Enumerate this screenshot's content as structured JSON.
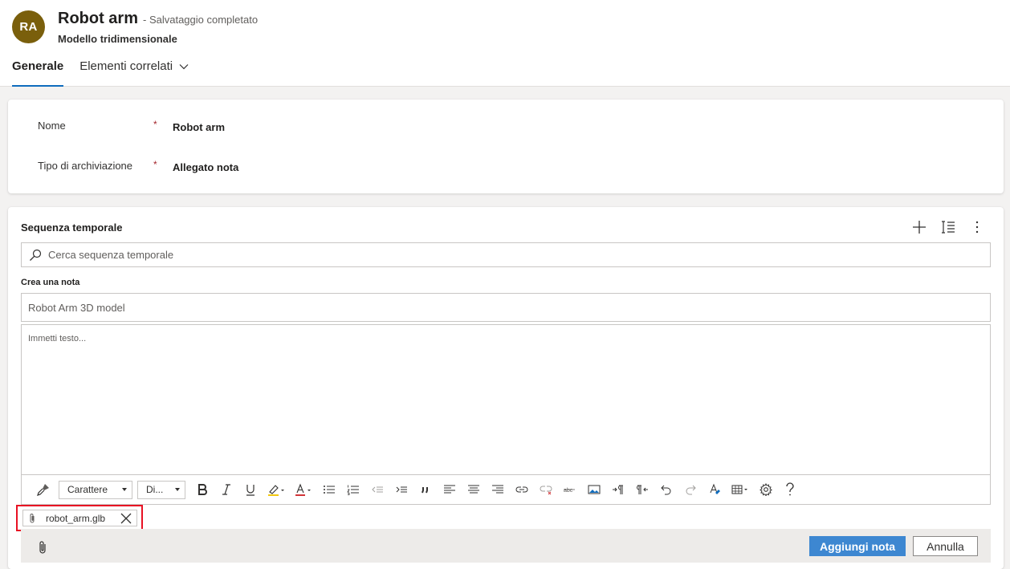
{
  "header": {
    "avatar_initials": "RA",
    "avatar_color": "#7a5f0c",
    "title": "Robot arm",
    "save_status": "- Salvataggio completato",
    "subtitle": "Modello tridimensionale",
    "tabs": [
      {
        "label": "Generale",
        "active": true
      },
      {
        "label": "Elementi correlati",
        "active": false
      }
    ],
    "accent_color": "#0f6cbd"
  },
  "general": {
    "fields": [
      {
        "label": "Nome",
        "required_marker": "*",
        "value": "Robot arm"
      },
      {
        "label": "Tipo di archiviazione",
        "required_marker": "*",
        "value": "Allegato nota"
      }
    ]
  },
  "timeline": {
    "title": "Sequenza temporale",
    "tools": [
      "plus-icon",
      "sort-list-icon",
      "more-vertical-icon"
    ],
    "search": {
      "placeholder": "Cerca sequenza temporale",
      "value": ""
    },
    "create_note_label": "Crea una nota",
    "note_title_value": "Robot Arm 3D model",
    "editor_placeholder": "Immetti testo...",
    "toolbar": {
      "font_select": "Carattere",
      "size_select": "Di..."
    },
    "attachment": {
      "filename": "robot_arm.glb",
      "highlight_color": "#e81123"
    },
    "buttons": {
      "add_note": "Aggiungi nota",
      "cancel": "Annulla"
    }
  }
}
